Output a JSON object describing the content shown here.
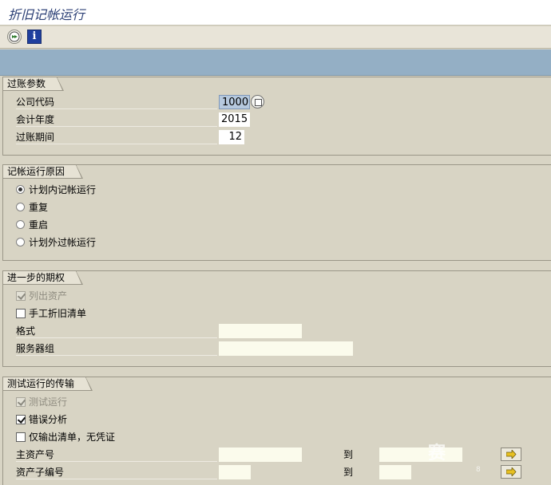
{
  "window": {
    "title": "折旧记帐运行"
  },
  "toolbar": {
    "execute_icon": "execute-icon",
    "info_icon": "info-icon",
    "info_glyph": "i"
  },
  "posting_params": {
    "title": "过账参数",
    "company_code": {
      "label": "公司代码",
      "value": "1000"
    },
    "fiscal_year": {
      "label": "会计年度",
      "value": "2015"
    },
    "posting_period": {
      "label": "过账期间",
      "value": "12"
    }
  },
  "run_reason": {
    "title": "记帐运行原因",
    "options": [
      {
        "label": "计划内记帐运行",
        "selected": true
      },
      {
        "label": "重复",
        "selected": false
      },
      {
        "label": "重启",
        "selected": false
      },
      {
        "label": "计划外过帐运行",
        "selected": false
      }
    ]
  },
  "further_options": {
    "title": "进一步的期权",
    "list_assets": {
      "label": "列出资产",
      "checked": true,
      "disabled": true
    },
    "manual_depreciation": {
      "label": "手工折旧清单",
      "checked": false
    },
    "format": {
      "label": "格式",
      "value": ""
    },
    "server_group": {
      "label": "服务器组",
      "value": ""
    }
  },
  "test_run": {
    "title": "测试运行的传输",
    "test_run_check": {
      "label": "测试运行",
      "checked": true,
      "disabled": true
    },
    "error_analysis": {
      "label": "错误分析",
      "checked": true
    },
    "list_only": {
      "label": "仅输出清单，无凭证",
      "checked": false
    },
    "main_asset": {
      "label": "主资产号",
      "to_label": "到"
    },
    "sub_number": {
      "label": "资产子编号",
      "to_label": "到"
    }
  },
  "watermark": {
    "text": "赛",
    "sub": "8"
  },
  "colors": {
    "background": "#d8d4c4",
    "band": "#94afc5",
    "title": "#2b3f75",
    "input": "#fbfbec"
  }
}
